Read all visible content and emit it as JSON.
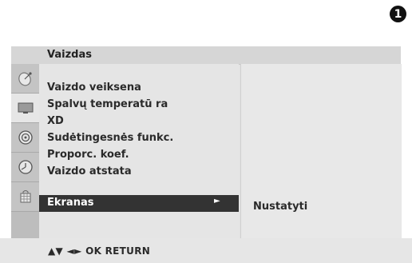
{
  "step_badge": "1",
  "menu": {
    "title": "Vaizdas",
    "items": [
      "Vaizdo veiksena",
      "Spalvų temperatū ra",
      "XD",
      "Sudėtingesnės funkc.",
      "Proporc. koef.",
      "Vaizdo atstata"
    ],
    "selected": {
      "label": "Ekranas",
      "arrow": "►",
      "submenu_value": "Nustatyti"
    }
  },
  "side_icons": [
    "satellite-dish-icon",
    "tv-screen-icon",
    "speaker-icon",
    "clock-icon",
    "lock-grid-icon"
  ],
  "active_icon": "tv-screen-icon",
  "footer": {
    "hint": "▲▼ ◄► OK RETURN"
  }
}
